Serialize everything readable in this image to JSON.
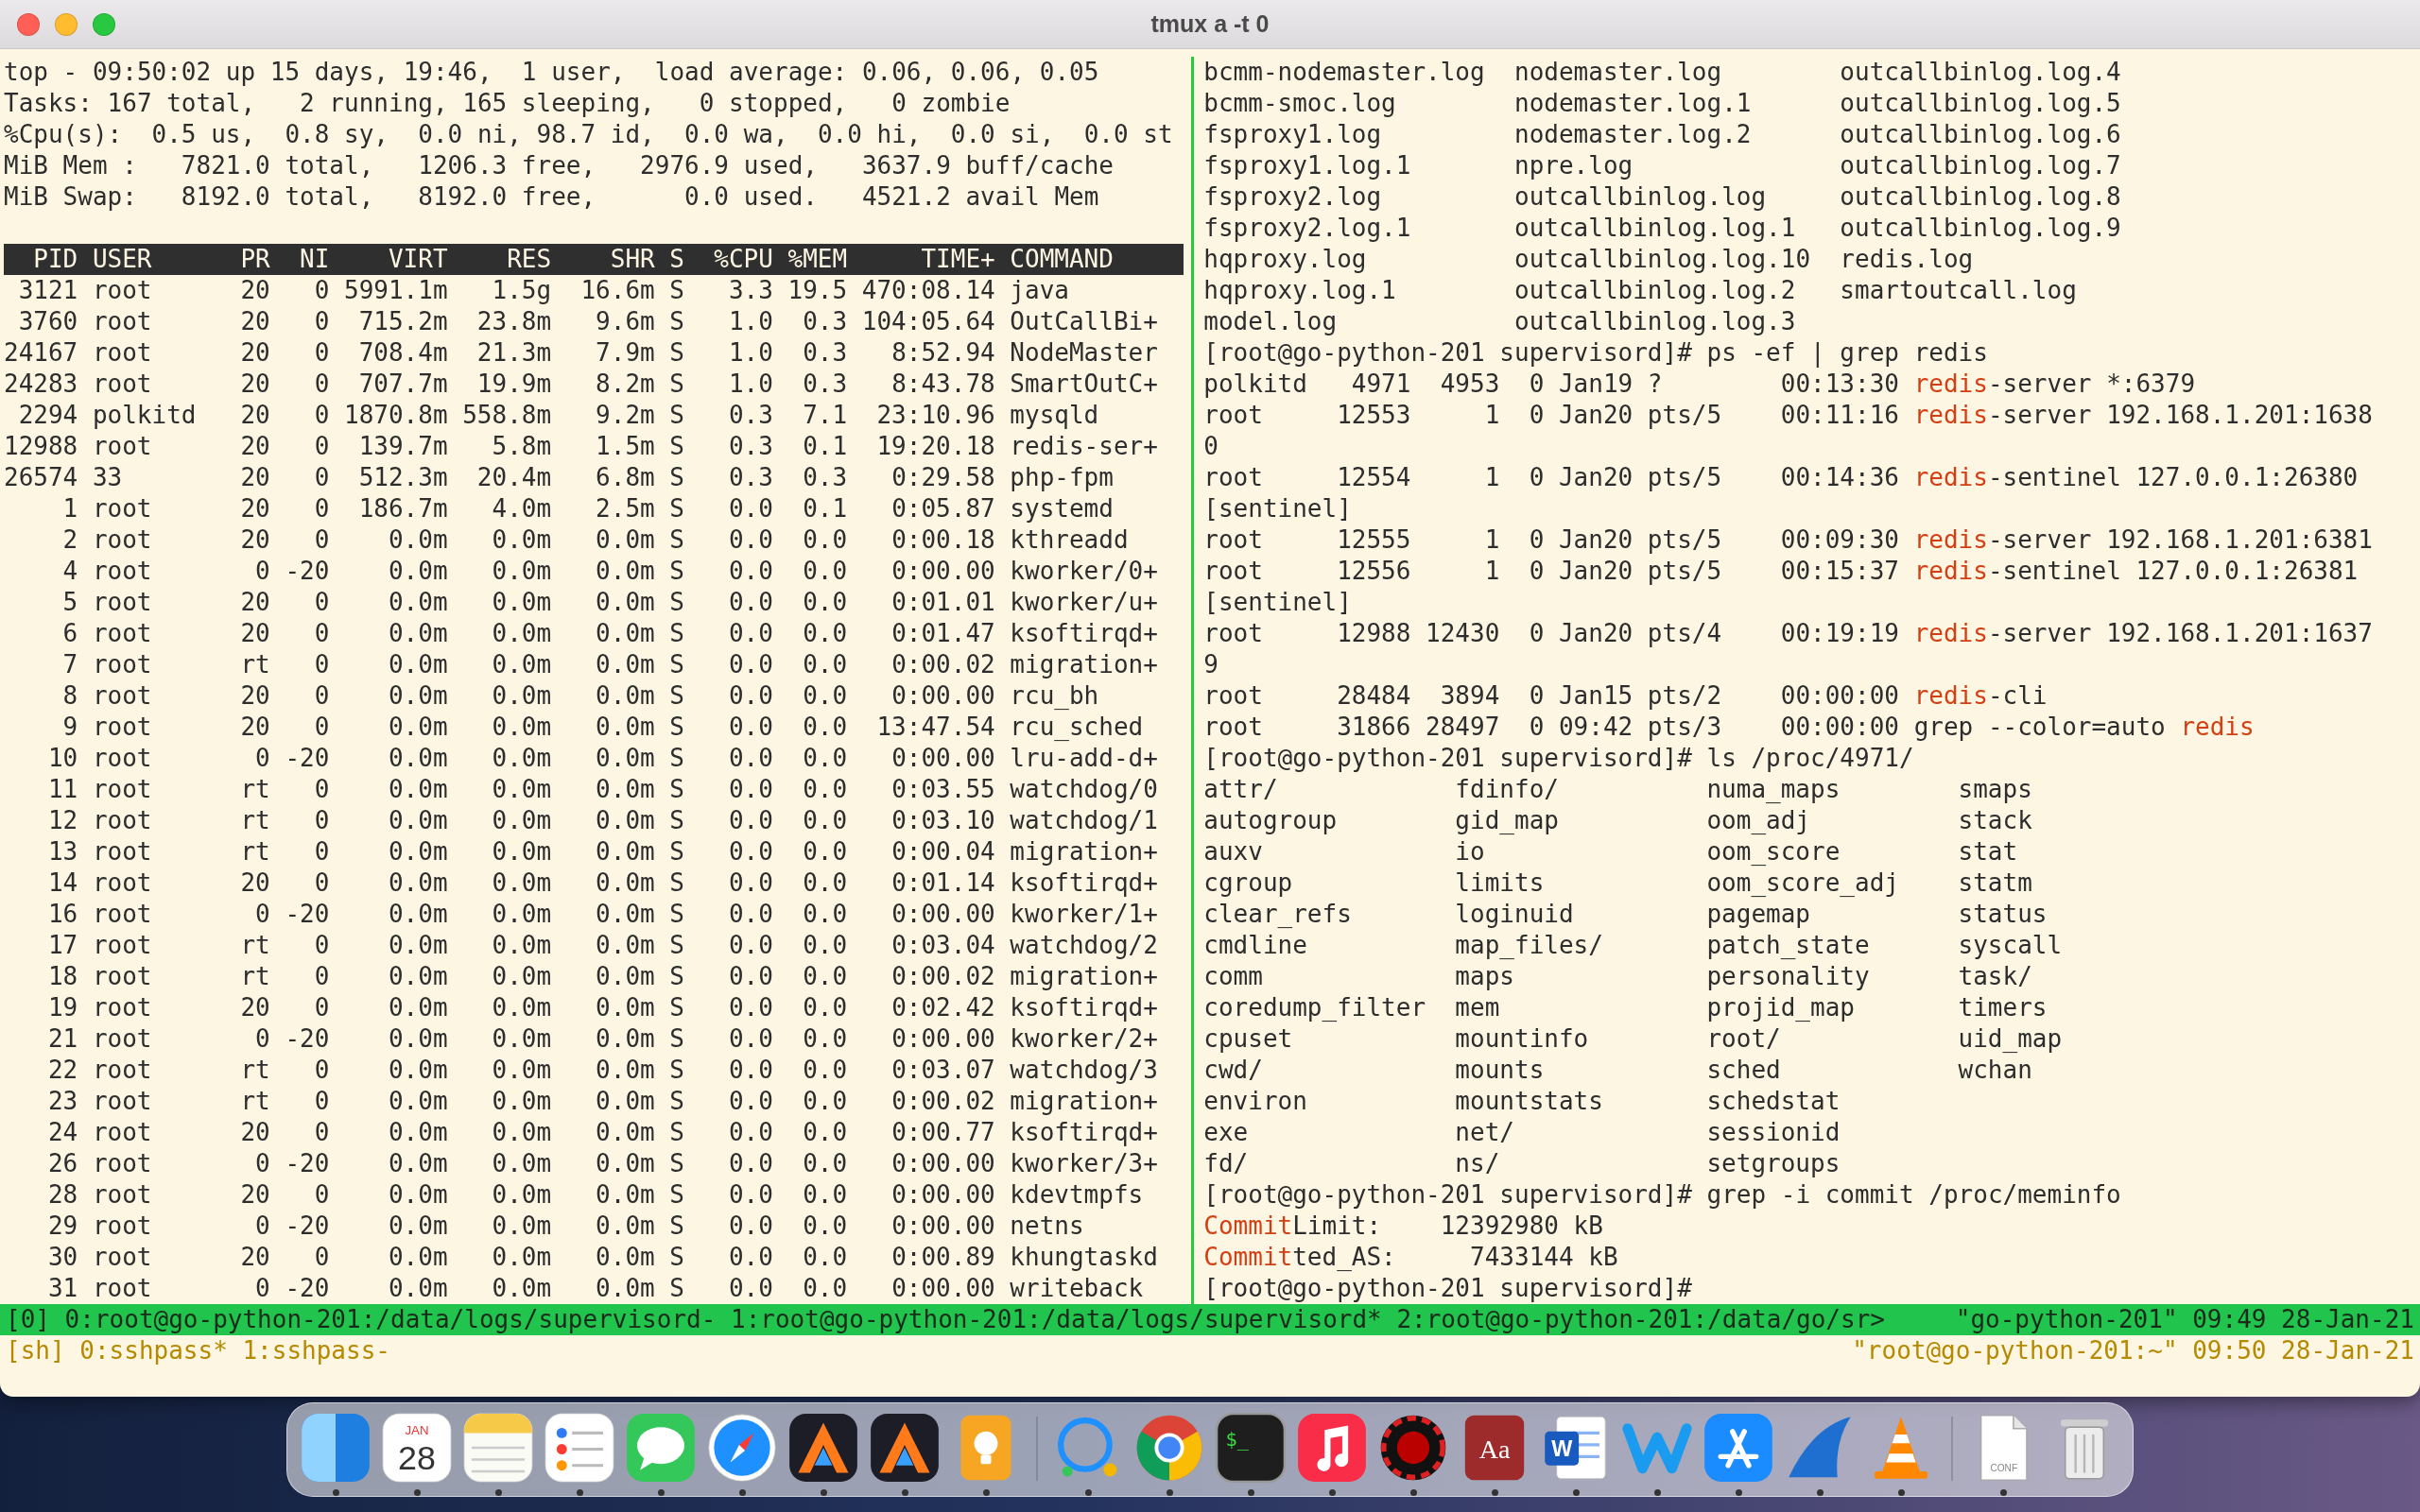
{
  "window": {
    "title": "tmux a -t 0"
  },
  "top_pane": {
    "summary": [
      "top - 09:50:02 up 15 days, 19:46,  1 user,  load average: 0.06, 0.06, 0.05",
      "Tasks: 167 total,   2 running, 165 sleeping,   0 stopped,   0 zombie",
      "%Cpu(s):  0.5 us,  0.8 sy,  0.0 ni, 98.7 id,  0.0 wa,  0.0 hi,  0.0 si,  0.0 st",
      "MiB Mem :   7821.0 total,   1206.3 free,   2976.9 used,   3637.9 buff/cache",
      "MiB Swap:   8192.0 total,   8192.0 free,      0.0 used.   4521.2 avail Mem"
    ],
    "columns": [
      "PID",
      "USER",
      "PR",
      "NI",
      "VIRT",
      "RES",
      "SHR",
      "S",
      "%CPU",
      "%MEM",
      "TIME+",
      "COMMAND"
    ],
    "processes": [
      [
        "3121",
        "root",
        "20",
        "0",
        "5991.1m",
        "1.5g",
        "16.6m",
        "S",
        "3.3",
        "19.5",
        "470:08.14",
        "java"
      ],
      [
        "3760",
        "root",
        "20",
        "0",
        "715.2m",
        "23.8m",
        "9.6m",
        "S",
        "1.0",
        "0.3",
        "104:05.64",
        "OutCallBi+"
      ],
      [
        "24167",
        "root",
        "20",
        "0",
        "708.4m",
        "21.3m",
        "7.9m",
        "S",
        "1.0",
        "0.3",
        "8:52.94",
        "NodeMaster"
      ],
      [
        "24283",
        "root",
        "20",
        "0",
        "707.7m",
        "19.9m",
        "8.2m",
        "S",
        "1.0",
        "0.3",
        "8:43.78",
        "SmartOutC+"
      ],
      [
        "2294",
        "polkitd",
        "20",
        "0",
        "1870.8m",
        "558.8m",
        "9.2m",
        "S",
        "0.3",
        "7.1",
        "23:10.96",
        "mysqld"
      ],
      [
        "12988",
        "root",
        "20",
        "0",
        "139.7m",
        "5.8m",
        "1.5m",
        "S",
        "0.3",
        "0.1",
        "19:20.18",
        "redis-ser+"
      ],
      [
        "26574",
        "33",
        "20",
        "0",
        "512.3m",
        "20.4m",
        "6.8m",
        "S",
        "0.3",
        "0.3",
        "0:29.58",
        "php-fpm"
      ],
      [
        "1",
        "root",
        "20",
        "0",
        "186.7m",
        "4.0m",
        "2.5m",
        "S",
        "0.0",
        "0.1",
        "0:05.87",
        "systemd"
      ],
      [
        "2",
        "root",
        "20",
        "0",
        "0.0m",
        "0.0m",
        "0.0m",
        "S",
        "0.0",
        "0.0",
        "0:00.18",
        "kthreadd"
      ],
      [
        "4",
        "root",
        "0",
        "-20",
        "0.0m",
        "0.0m",
        "0.0m",
        "S",
        "0.0",
        "0.0",
        "0:00.00",
        "kworker/0+"
      ],
      [
        "5",
        "root",
        "20",
        "0",
        "0.0m",
        "0.0m",
        "0.0m",
        "S",
        "0.0",
        "0.0",
        "0:01.01",
        "kworker/u+"
      ],
      [
        "6",
        "root",
        "20",
        "0",
        "0.0m",
        "0.0m",
        "0.0m",
        "S",
        "0.0",
        "0.0",
        "0:01.47",
        "ksoftirqd+"
      ],
      [
        "7",
        "root",
        "rt",
        "0",
        "0.0m",
        "0.0m",
        "0.0m",
        "S",
        "0.0",
        "0.0",
        "0:00.02",
        "migration+"
      ],
      [
        "8",
        "root",
        "20",
        "0",
        "0.0m",
        "0.0m",
        "0.0m",
        "S",
        "0.0",
        "0.0",
        "0:00.00",
        "rcu_bh"
      ],
      [
        "9",
        "root",
        "20",
        "0",
        "0.0m",
        "0.0m",
        "0.0m",
        "S",
        "0.0",
        "0.0",
        "13:47.54",
        "rcu_sched"
      ],
      [
        "10",
        "root",
        "0",
        "-20",
        "0.0m",
        "0.0m",
        "0.0m",
        "S",
        "0.0",
        "0.0",
        "0:00.00",
        "lru-add-d+"
      ],
      [
        "11",
        "root",
        "rt",
        "0",
        "0.0m",
        "0.0m",
        "0.0m",
        "S",
        "0.0",
        "0.0",
        "0:03.55",
        "watchdog/0"
      ],
      [
        "12",
        "root",
        "rt",
        "0",
        "0.0m",
        "0.0m",
        "0.0m",
        "S",
        "0.0",
        "0.0",
        "0:03.10",
        "watchdog/1"
      ],
      [
        "13",
        "root",
        "rt",
        "0",
        "0.0m",
        "0.0m",
        "0.0m",
        "S",
        "0.0",
        "0.0",
        "0:00.04",
        "migration+"
      ],
      [
        "14",
        "root",
        "20",
        "0",
        "0.0m",
        "0.0m",
        "0.0m",
        "S",
        "0.0",
        "0.0",
        "0:01.14",
        "ksoftirqd+"
      ],
      [
        "16",
        "root",
        "0",
        "-20",
        "0.0m",
        "0.0m",
        "0.0m",
        "S",
        "0.0",
        "0.0",
        "0:00.00",
        "kworker/1+"
      ],
      [
        "17",
        "root",
        "rt",
        "0",
        "0.0m",
        "0.0m",
        "0.0m",
        "S",
        "0.0",
        "0.0",
        "0:03.04",
        "watchdog/2"
      ],
      [
        "18",
        "root",
        "rt",
        "0",
        "0.0m",
        "0.0m",
        "0.0m",
        "S",
        "0.0",
        "0.0",
        "0:00.02",
        "migration+"
      ],
      [
        "19",
        "root",
        "20",
        "0",
        "0.0m",
        "0.0m",
        "0.0m",
        "S",
        "0.0",
        "0.0",
        "0:02.42",
        "ksoftirqd+"
      ],
      [
        "21",
        "root",
        "0",
        "-20",
        "0.0m",
        "0.0m",
        "0.0m",
        "S",
        "0.0",
        "0.0",
        "0:00.00",
        "kworker/2+"
      ],
      [
        "22",
        "root",
        "rt",
        "0",
        "0.0m",
        "0.0m",
        "0.0m",
        "S",
        "0.0",
        "0.0",
        "0:03.07",
        "watchdog/3"
      ],
      [
        "23",
        "root",
        "rt",
        "0",
        "0.0m",
        "0.0m",
        "0.0m",
        "S",
        "0.0",
        "0.0",
        "0:00.02",
        "migration+"
      ],
      [
        "24",
        "root",
        "20",
        "0",
        "0.0m",
        "0.0m",
        "0.0m",
        "S",
        "0.0",
        "0.0",
        "0:00.77",
        "ksoftirqd+"
      ],
      [
        "26",
        "root",
        "0",
        "-20",
        "0.0m",
        "0.0m",
        "0.0m",
        "S",
        "0.0",
        "0.0",
        "0:00.00",
        "kworker/3+"
      ],
      [
        "28",
        "root",
        "20",
        "0",
        "0.0m",
        "0.0m",
        "0.0m",
        "S",
        "0.0",
        "0.0",
        "0:00.00",
        "kdevtmpfs"
      ],
      [
        "29",
        "root",
        "0",
        "-20",
        "0.0m",
        "0.0m",
        "0.0m",
        "S",
        "0.0",
        "0.0",
        "0:00.00",
        "netns"
      ],
      [
        "30",
        "root",
        "20",
        "0",
        "0.0m",
        "0.0m",
        "0.0m",
        "S",
        "0.0",
        "0.0",
        "0:00.89",
        "khungtaskd"
      ],
      [
        "31",
        "root",
        "0",
        "-20",
        "0.0m",
        "0.0m",
        "0.0m",
        "S",
        "0.0",
        "0.0",
        "0:00.00",
        "writeback"
      ]
    ]
  },
  "shell_pane": {
    "lines": [
      {
        "kind": "listing",
        "columns": [
          [
            "bcmm-nodemaster.log",
            "bcmm-smoc.log",
            "fsproxy1.log",
            "fsproxy1.log.1",
            "fsproxy2.log",
            "fsproxy2.log.1",
            "hqproxy.log",
            "hqproxy.log.1",
            "model.log"
          ],
          [
            "nodemaster.log",
            "nodemaster.log.1",
            "nodemaster.log.2",
            "npre.log",
            "outcallbinlog.log",
            "outcallbinlog.log.1",
            "outcallbinlog.log.10",
            "outcallbinlog.log.2",
            "outcallbinlog.log.3"
          ],
          [
            "outcallbinlog.log.4",
            "outcallbinlog.log.5",
            "outcallbinlog.log.6",
            "outcallbinlog.log.7",
            "outcallbinlog.log.8",
            "outcallbinlog.log.9",
            "redis.log",
            "smartoutcall.log"
          ]
        ]
      },
      {
        "kind": "text",
        "parts": [
          {
            "text": "[root@go-python-201 supervisord]# ps -ef | grep redis",
            "match": false
          }
        ]
      },
      {
        "kind": "text",
        "parts": [
          {
            "text": "polkitd   4971  4953  0 Jan19 ?        00:13:30 ",
            "match": false
          },
          {
            "text": "redis",
            "match": true
          },
          {
            "text": "-server *:6379",
            "match": false
          }
        ]
      },
      {
        "kind": "text",
        "parts": [
          {
            "text": "root     12553     1  0 Jan20 pts/5    00:11:16 ",
            "match": false
          },
          {
            "text": "redis",
            "match": true
          },
          {
            "text": "-server 192.168.1.201:1638",
            "match": false
          }
        ]
      },
      {
        "kind": "text",
        "parts": [
          {
            "text": "0",
            "match": false
          }
        ]
      },
      {
        "kind": "text",
        "parts": [
          {
            "text": "root     12554     1  0 Jan20 pts/5    00:14:36 ",
            "match": false
          },
          {
            "text": "redis",
            "match": true
          },
          {
            "text": "-sentinel 127.0.0.1:26380",
            "match": false
          }
        ]
      },
      {
        "kind": "text",
        "parts": [
          {
            "text": "[sentinel]",
            "match": false
          }
        ]
      },
      {
        "kind": "text",
        "parts": [
          {
            "text": "root     12555     1  0 Jan20 pts/5    00:09:30 ",
            "match": false
          },
          {
            "text": "redis",
            "match": true
          },
          {
            "text": "-server 192.168.1.201:6381",
            "match": false
          }
        ]
      },
      {
        "kind": "text",
        "parts": [
          {
            "text": "root     12556     1  0 Jan20 pts/5    00:15:37 ",
            "match": false
          },
          {
            "text": "redis",
            "match": true
          },
          {
            "text": "-sentinel 127.0.0.1:26381",
            "match": false
          }
        ]
      },
      {
        "kind": "text",
        "parts": [
          {
            "text": "[sentinel]",
            "match": false
          }
        ]
      },
      {
        "kind": "text",
        "parts": [
          {
            "text": "root     12988 12430  0 Jan20 pts/4    00:19:19 ",
            "match": false
          },
          {
            "text": "redis",
            "match": true
          },
          {
            "text": "-server 192.168.1.201:1637",
            "match": false
          }
        ]
      },
      {
        "kind": "text",
        "parts": [
          {
            "text": "9",
            "match": false
          }
        ]
      },
      {
        "kind": "text",
        "parts": [
          {
            "text": "root     28484  3894  0 Jan15 pts/2    00:00:00 ",
            "match": false
          },
          {
            "text": "redis",
            "match": true
          },
          {
            "text": "-cli",
            "match": false
          }
        ]
      },
      {
        "kind": "text",
        "parts": [
          {
            "text": "root     31866 28497  0 09:42 pts/3    00:00:00 grep --color=auto ",
            "match": false
          },
          {
            "text": "redis",
            "match": true
          }
        ]
      },
      {
        "kind": "text",
        "parts": [
          {
            "text": "[root@go-python-201 supervisord]# ls /proc/4971/",
            "match": false
          }
        ]
      },
      {
        "kind": "listing",
        "columns": [
          [
            "attr/",
            "autogroup",
            "auxv",
            "cgroup",
            "clear_refs",
            "cmdline",
            "comm",
            "coredump_filter",
            "cpuset",
            "cwd/",
            "environ",
            "exe",
            "fd/"
          ],
          [
            "fdinfo/",
            "gid_map",
            "io",
            "limits",
            "loginuid",
            "map_files/",
            "maps",
            "mem",
            "mountinfo",
            "mounts",
            "mountstats",
            "net/",
            "ns/"
          ],
          [
            "numa_maps",
            "oom_adj",
            "oom_score",
            "oom_score_adj",
            "pagemap",
            "patch_state",
            "personality",
            "projid_map",
            "root/",
            "sched",
            "schedstat",
            "sessionid",
            "setgroups"
          ],
          [
            "smaps",
            "stack",
            "stat",
            "statm",
            "status",
            "syscall",
            "task/",
            "timers",
            "uid_map",
            "wchan"
          ]
        ]
      },
      {
        "kind": "text",
        "parts": [
          {
            "text": "[root@go-python-201 supervisord]# grep -i commit /proc/meminfo",
            "match": false
          }
        ]
      },
      {
        "kind": "text",
        "parts": [
          {
            "text": "Commit",
            "match": true
          },
          {
            "text": "Limit:    12392980 kB",
            "match": false
          }
        ]
      },
      {
        "kind": "text",
        "parts": [
          {
            "text": "Commit",
            "match": true
          },
          {
            "text": "ted_AS:     7433144 kB",
            "match": false
          }
        ]
      },
      {
        "kind": "text",
        "parts": [
          {
            "text": "[root@go-python-201 supervisord]#",
            "match": false
          }
        ]
      }
    ]
  },
  "status_bar": {
    "session": "[0]",
    "windows": [
      "0:root@go-python-201:/data/logs/supervisord-",
      "1:root@go-python-201:/data/logs/supervisord*",
      "2:root@go-python-201:/data/go/sr>"
    ],
    "info": "\"go-python-201\" 09:49 28-Jan-21"
  },
  "client_bar": {
    "session": "[sh]",
    "windows": [
      "0:sshpass*",
      "1:sshpass-"
    ],
    "info": "\"root@go-python-201:~\" 09:50 28-Jan-21"
  },
  "dock": {
    "items": [
      {
        "kind": "finder",
        "running": true
      },
      {
        "kind": "calendar",
        "running": true,
        "month": "JAN",
        "day": "28"
      },
      {
        "kind": "notes",
        "running": true
      },
      {
        "kind": "reminders",
        "running": true
      },
      {
        "kind": "messages",
        "running": true
      },
      {
        "kind": "compass",
        "running": true
      },
      {
        "kind": "peak",
        "running": true
      },
      {
        "kind": "peak",
        "running": true
      },
      {
        "kind": "bulb",
        "running": true
      },
      {
        "kind": "separator"
      },
      {
        "kind": "bubble",
        "running": true
      },
      {
        "kind": "wheel",
        "running": true
      },
      {
        "kind": "terminal",
        "running": true,
        "label": "$_"
      },
      {
        "kind": "music",
        "running": true
      },
      {
        "kind": "chip",
        "running": true
      },
      {
        "kind": "dictionary",
        "running": true,
        "label": "Aa"
      },
      {
        "kind": "word",
        "running": true,
        "label": "W"
      },
      {
        "kind": "zigzag",
        "running": true
      },
      {
        "kind": "store",
        "running": true
      },
      {
        "kind": "fin",
        "running": true
      },
      {
        "kind": "cone",
        "running": true
      },
      {
        "kind": "separator"
      },
      {
        "kind": "file",
        "running": true,
        "label": "CONF"
      },
      {
        "kind": "trash",
        "running": false
      }
    ]
  }
}
